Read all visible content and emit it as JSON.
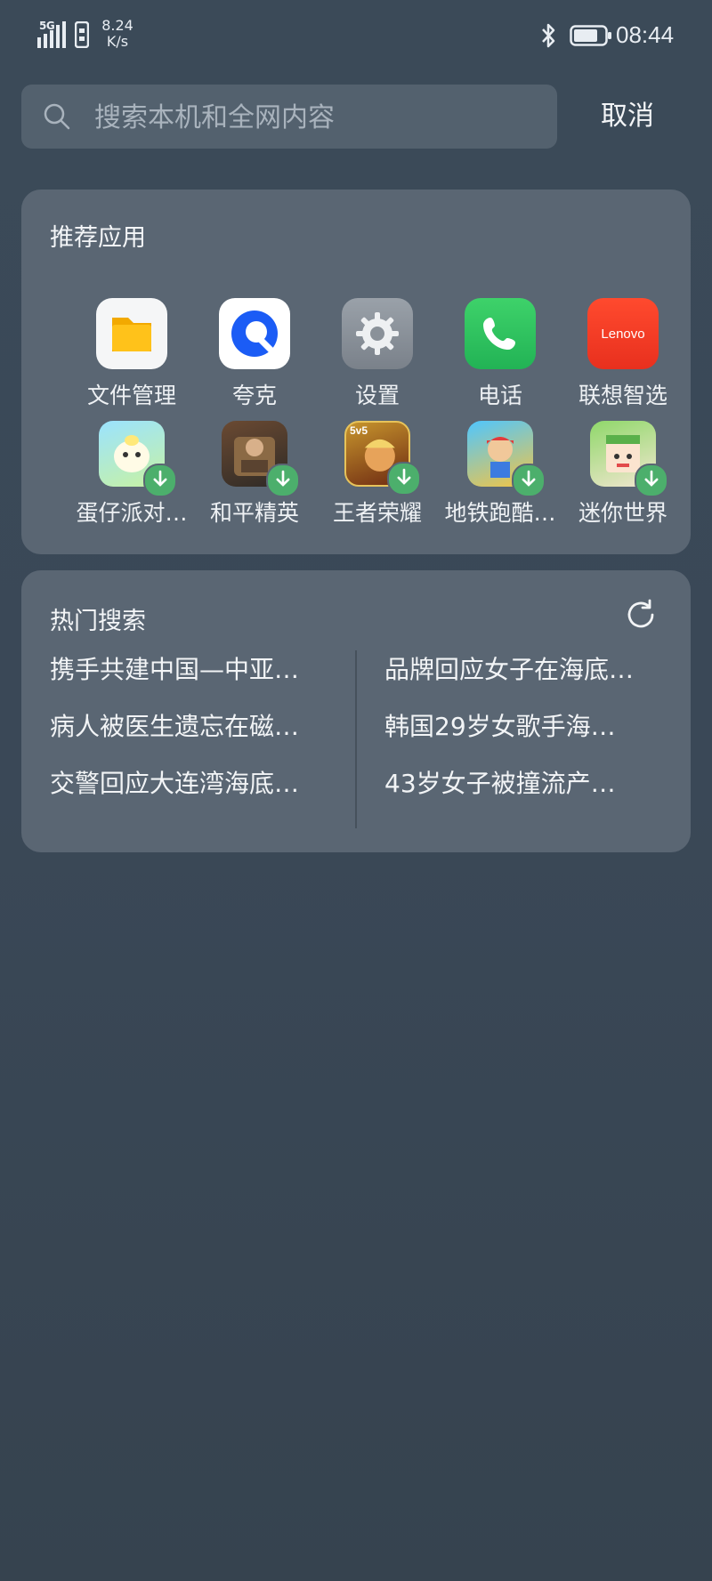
{
  "status_bar": {
    "network": "5G",
    "speed_value": "8.24",
    "speed_unit": "K/s",
    "time": "08:44",
    "icons": [
      "signal-icon",
      "sim-icon",
      "bluetooth-icon",
      "battery-icon"
    ]
  },
  "search": {
    "placeholder": "搜索本机和全网内容",
    "value": "",
    "cancel_label": "取消"
  },
  "recommended": {
    "title": "推荐应用",
    "apps": [
      {
        "label": "文件管理",
        "icon": "files-icon"
      },
      {
        "label": "夸克",
        "icon": "quark-icon"
      },
      {
        "label": "设置",
        "icon": "settings-icon"
      },
      {
        "label": "电话",
        "icon": "phone-icon"
      },
      {
        "label": "联想智选",
        "icon": "lenovo-icon",
        "icon_text": "Lenovo"
      },
      {
        "label": "蛋仔派对…",
        "icon": "eggy-party-icon",
        "download": true
      },
      {
        "label": "和平精英",
        "icon": "peace-elite-icon",
        "download": true
      },
      {
        "label": "王者荣耀",
        "icon": "honor-of-kings-icon",
        "download": true,
        "icon_text": "5v5"
      },
      {
        "label": "地铁跑酷…",
        "icon": "subway-surfers-icon",
        "download": true
      },
      {
        "label": "迷你世界",
        "icon": "mini-world-icon",
        "download": true
      }
    ]
  },
  "hot_search": {
    "title": "热门搜索",
    "left": [
      "携手共建中国—中亚…",
      "病人被医生遗忘在磁…",
      "交警回应大连湾海底…"
    ],
    "right": [
      "品牌回应女子在海底…",
      "韩国29岁女歌手海…",
      "43岁女子被撞流产…"
    ]
  },
  "colors": {
    "background": "#3a4857",
    "card": "#5a6673",
    "search_box": "#53616e",
    "download_badge": "#4caf6c"
  }
}
